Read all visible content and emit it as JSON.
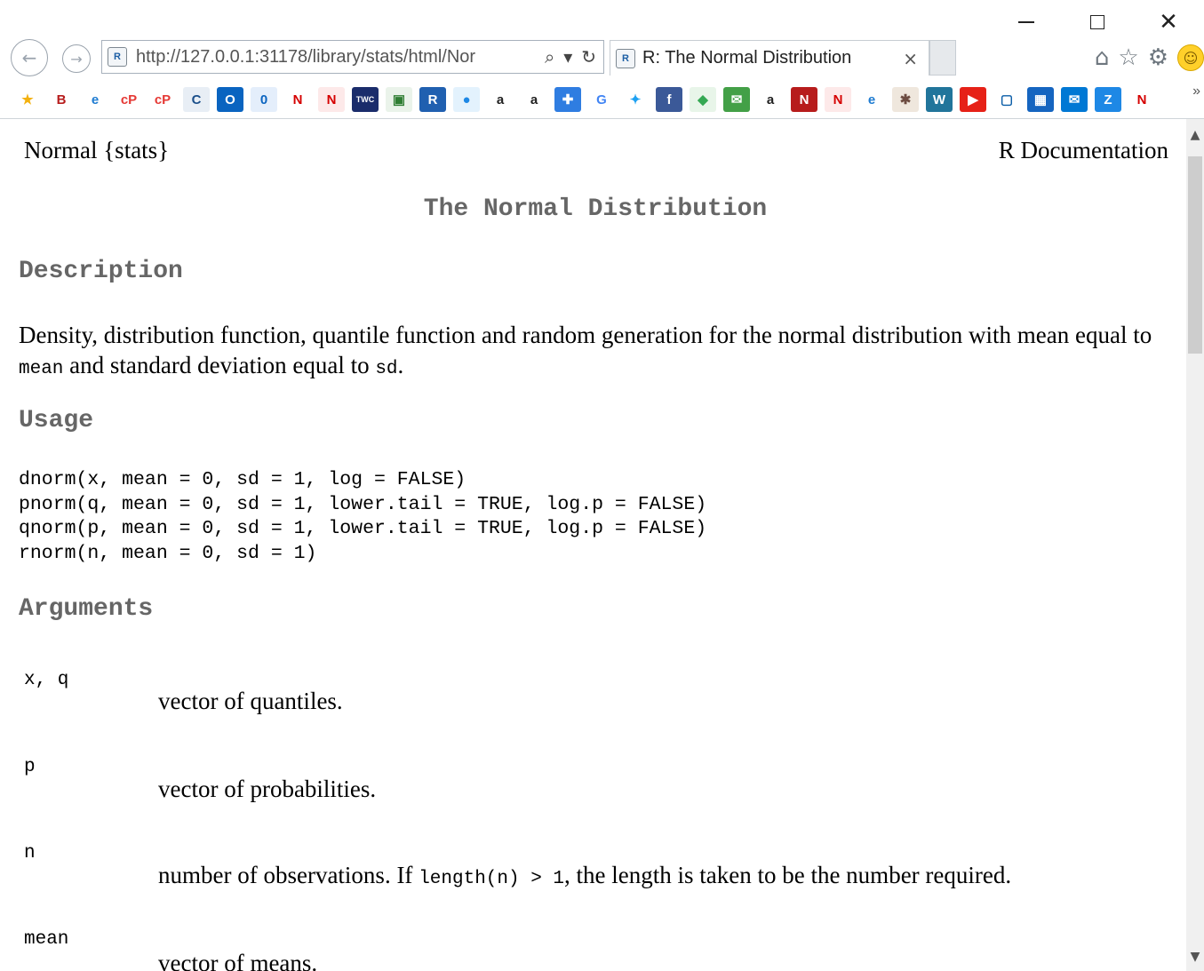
{
  "browser": {
    "url": "http://127.0.0.1:31178/library/stats/html/Nor",
    "tab_title": "R: The Normal Distribution",
    "site_icon_text": "R",
    "search_glyph": "⌕",
    "dropdown_glyph": "▾",
    "refresh_glyph": "↻",
    "close_tab_glyph": "×",
    "back_glyph": "←",
    "forward_glyph": "→",
    "home_glyph": "⌂",
    "star_glyph": "☆",
    "gear_glyph": "⚙",
    "smiley_glyph": "☺",
    "window_close_glyph": "✕",
    "chevron_glyph": "»"
  },
  "favorites": [
    {
      "icon": "star-icon",
      "glyph": "★",
      "color": "#f3b10f",
      "bg": "transparent"
    },
    {
      "icon": "b-icon",
      "glyph": "B",
      "color": "#b71c1c",
      "bg": "#fff"
    },
    {
      "icon": "ie-icon",
      "glyph": "e",
      "color": "#1e7bd1",
      "bg": "#fff"
    },
    {
      "icon": "cp-icon",
      "glyph": "cP",
      "color": "#e53935",
      "bg": "transparent"
    },
    {
      "icon": "cp-icon-2",
      "glyph": "cP",
      "color": "#e53935",
      "bg": "transparent"
    },
    {
      "icon": "c-icon",
      "glyph": "C",
      "color": "#1b4f8a",
      "bg": "#e8eef5"
    },
    {
      "icon": "outlook-icon",
      "glyph": "O",
      "color": "#ffffff",
      "bg": "#0a64c0"
    },
    {
      "icon": "zero-icon",
      "glyph": "0",
      "color": "#0a64c0",
      "bg": "#e4eefb"
    },
    {
      "icon": "n-icon",
      "glyph": "N",
      "color": "#d50000",
      "bg": "transparent"
    },
    {
      "icon": "n-box-icon",
      "glyph": "N",
      "color": "#d50000",
      "bg": "#fde9e9"
    },
    {
      "icon": "twc-icon",
      "glyph": "TWC",
      "color": "#ffffff",
      "bg": "#1a2c6b"
    },
    {
      "icon": "image-icon",
      "glyph": "▣",
      "color": "#2e7d32",
      "bg": "#eaf3ea"
    },
    {
      "icon": "r-icon",
      "glyph": "R",
      "color": "#ffffff",
      "bg": "#2060b0"
    },
    {
      "icon": "dot-icon",
      "glyph": "●",
      "color": "#1e88e5",
      "bg": "#e3f2fd"
    },
    {
      "icon": "amazon-icon",
      "glyph": "a",
      "color": "#222222",
      "bg": "transparent"
    },
    {
      "icon": "amazon-icon-2",
      "glyph": "a",
      "color": "#222222",
      "bg": "transparent"
    },
    {
      "icon": "puzzle-icon",
      "glyph": "✚",
      "color": "#ffffff",
      "bg": "#2f7de1"
    },
    {
      "icon": "google-icon",
      "glyph": "G",
      "color": "#4285f4",
      "bg": "transparent"
    },
    {
      "icon": "twitter-icon",
      "glyph": "✦",
      "color": "#1da1f2",
      "bg": "transparent"
    },
    {
      "icon": "facebook-icon",
      "glyph": "f",
      "color": "#ffffff",
      "bg": "#3b5998"
    },
    {
      "icon": "maps-icon",
      "glyph": "◆",
      "color": "#34a853",
      "bg": "#e8f5e9"
    },
    {
      "icon": "mail3-icon",
      "glyph": "✉",
      "color": "#ffffff",
      "bg": "#43a047"
    },
    {
      "icon": "amazon-icon-3",
      "glyph": "a",
      "color": "#222222",
      "bg": "transparent"
    },
    {
      "icon": "n-dark-icon",
      "glyph": "N",
      "color": "#ffffff",
      "bg": "#b71c1c"
    },
    {
      "icon": "n-box-icon-2",
      "glyph": "N",
      "color": "#d50000",
      "bg": "#fde9e9"
    },
    {
      "icon": "ie-icon-2",
      "glyph": "e",
      "color": "#1e7bd1",
      "bg": "#fff"
    },
    {
      "icon": "bug-icon",
      "glyph": "✱",
      "color": "#6d4c41",
      "bg": "#efe7dd"
    },
    {
      "icon": "wordpress-icon",
      "glyph": "W",
      "color": "#ffffff",
      "bg": "#21759b"
    },
    {
      "icon": "youtube-icon",
      "glyph": "▶",
      "color": "#ffffff",
      "bg": "#e62117"
    },
    {
      "icon": "square-icon",
      "glyph": "▢",
      "color": "#0b5ea8",
      "bg": "#ffffff"
    },
    {
      "icon": "calendar-icon",
      "glyph": "▦",
      "color": "#ffffff",
      "bg": "#1565c0"
    },
    {
      "icon": "mail-icon",
      "glyph": "✉",
      "color": "#ffffff",
      "bg": "#0078d4"
    },
    {
      "icon": "z-icon",
      "glyph": "Z",
      "color": "#ffffff",
      "bg": "#1e88e5"
    },
    {
      "icon": "n-icon-2",
      "glyph": "N",
      "color": "#d50000",
      "bg": "transparent"
    }
  ],
  "doc": {
    "topic": "Normal {stats}",
    "source": "R Documentation",
    "title": "The Normal Distribution",
    "sections": {
      "description": "Description",
      "usage": "Usage",
      "arguments": "Arguments"
    },
    "description": {
      "text1": "Density, distribution function, quantile function and random generation for the normal distribution with mean equal to ",
      "code1": "mean",
      "text2": " and standard deviation equal to ",
      "code2": "sd",
      "text3": "."
    },
    "usage": "dnorm(x, mean = 0, sd = 1, log = FALSE)\npnorm(q, mean = 0, sd = 1, lower.tail = TRUE, log.p = FALSE)\nqnorm(p, mean = 0, sd = 1, lower.tail = TRUE, log.p = FALSE)\nrnorm(n, mean = 0, sd = 1)",
    "arguments": [
      {
        "name": "x, q",
        "desc": "vector of quantiles."
      },
      {
        "name": "p",
        "desc": "vector of probabilities."
      },
      {
        "name": "n",
        "desc_pre": "number of observations. If ",
        "desc_code": "length(n) > 1",
        "desc_post": ", the length is taken to be the number required."
      },
      {
        "name": "mean",
        "desc": "vector of means."
      }
    ]
  }
}
